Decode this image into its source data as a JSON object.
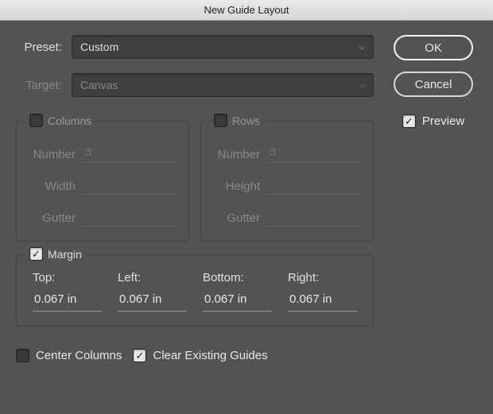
{
  "title": "New Guide Layout",
  "preset": {
    "label": "Preset:",
    "value": "Custom"
  },
  "target": {
    "label": "Target:",
    "value": "Canvas"
  },
  "buttons": {
    "ok": "OK",
    "cancel": "Cancel"
  },
  "preview": {
    "label": "Preview",
    "checked": true
  },
  "columns": {
    "title": "Columns",
    "checked": false,
    "number_label": "Number",
    "number_value": "3",
    "width_label": "Width",
    "width_value": "",
    "gutter_label": "Gutter",
    "gutter_value": ""
  },
  "rows": {
    "title": "Rows",
    "checked": false,
    "number_label": "Number",
    "number_value": "3",
    "height_label": "Height",
    "height_value": "",
    "gutter_label": "Gutter",
    "gutter_value": ""
  },
  "margin": {
    "title": "Margin",
    "checked": true,
    "top_label": "Top:",
    "top_value": "0.067 in",
    "left_label": "Left:",
    "left_value": "0.067 in",
    "bottom_label": "Bottom:",
    "bottom_value": "0.067 in",
    "right_label": "Right:",
    "right_value": "0.067 in"
  },
  "footer": {
    "center_columns_label": "Center Columns",
    "center_columns_checked": false,
    "clear_guides_label": "Clear Existing Guides",
    "clear_guides_checked": true
  }
}
